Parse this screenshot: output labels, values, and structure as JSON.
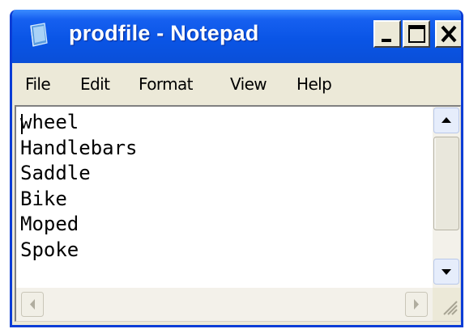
{
  "window": {
    "title": "prodfile - Notepad",
    "icon": "notepad-icon"
  },
  "title_buttons": {
    "minimize_icon": "minimize-icon",
    "maximize_icon": "maximize-icon",
    "close_icon": "close-icon"
  },
  "menu": {
    "items": [
      "File",
      "Edit",
      "Format",
      "View",
      "Help"
    ]
  },
  "editor": {
    "lines": [
      "wheel",
      "Handlebars",
      "Saddle",
      "Bike",
      "Moped",
      "Spoke"
    ]
  },
  "scrollbars": {
    "vertical": {
      "up_icon": "arrow-up-icon",
      "down_icon": "arrow-down-icon"
    },
    "horizontal": {
      "left_icon": "arrow-left-icon",
      "right_icon": "arrow-right-icon"
    },
    "grip_icon": "resize-grip-icon"
  },
  "colors": {
    "titlebar": "#0a55e6",
    "frame": "#0a3dd6",
    "chrome": "#ece9d8",
    "close_x": "#000000"
  }
}
